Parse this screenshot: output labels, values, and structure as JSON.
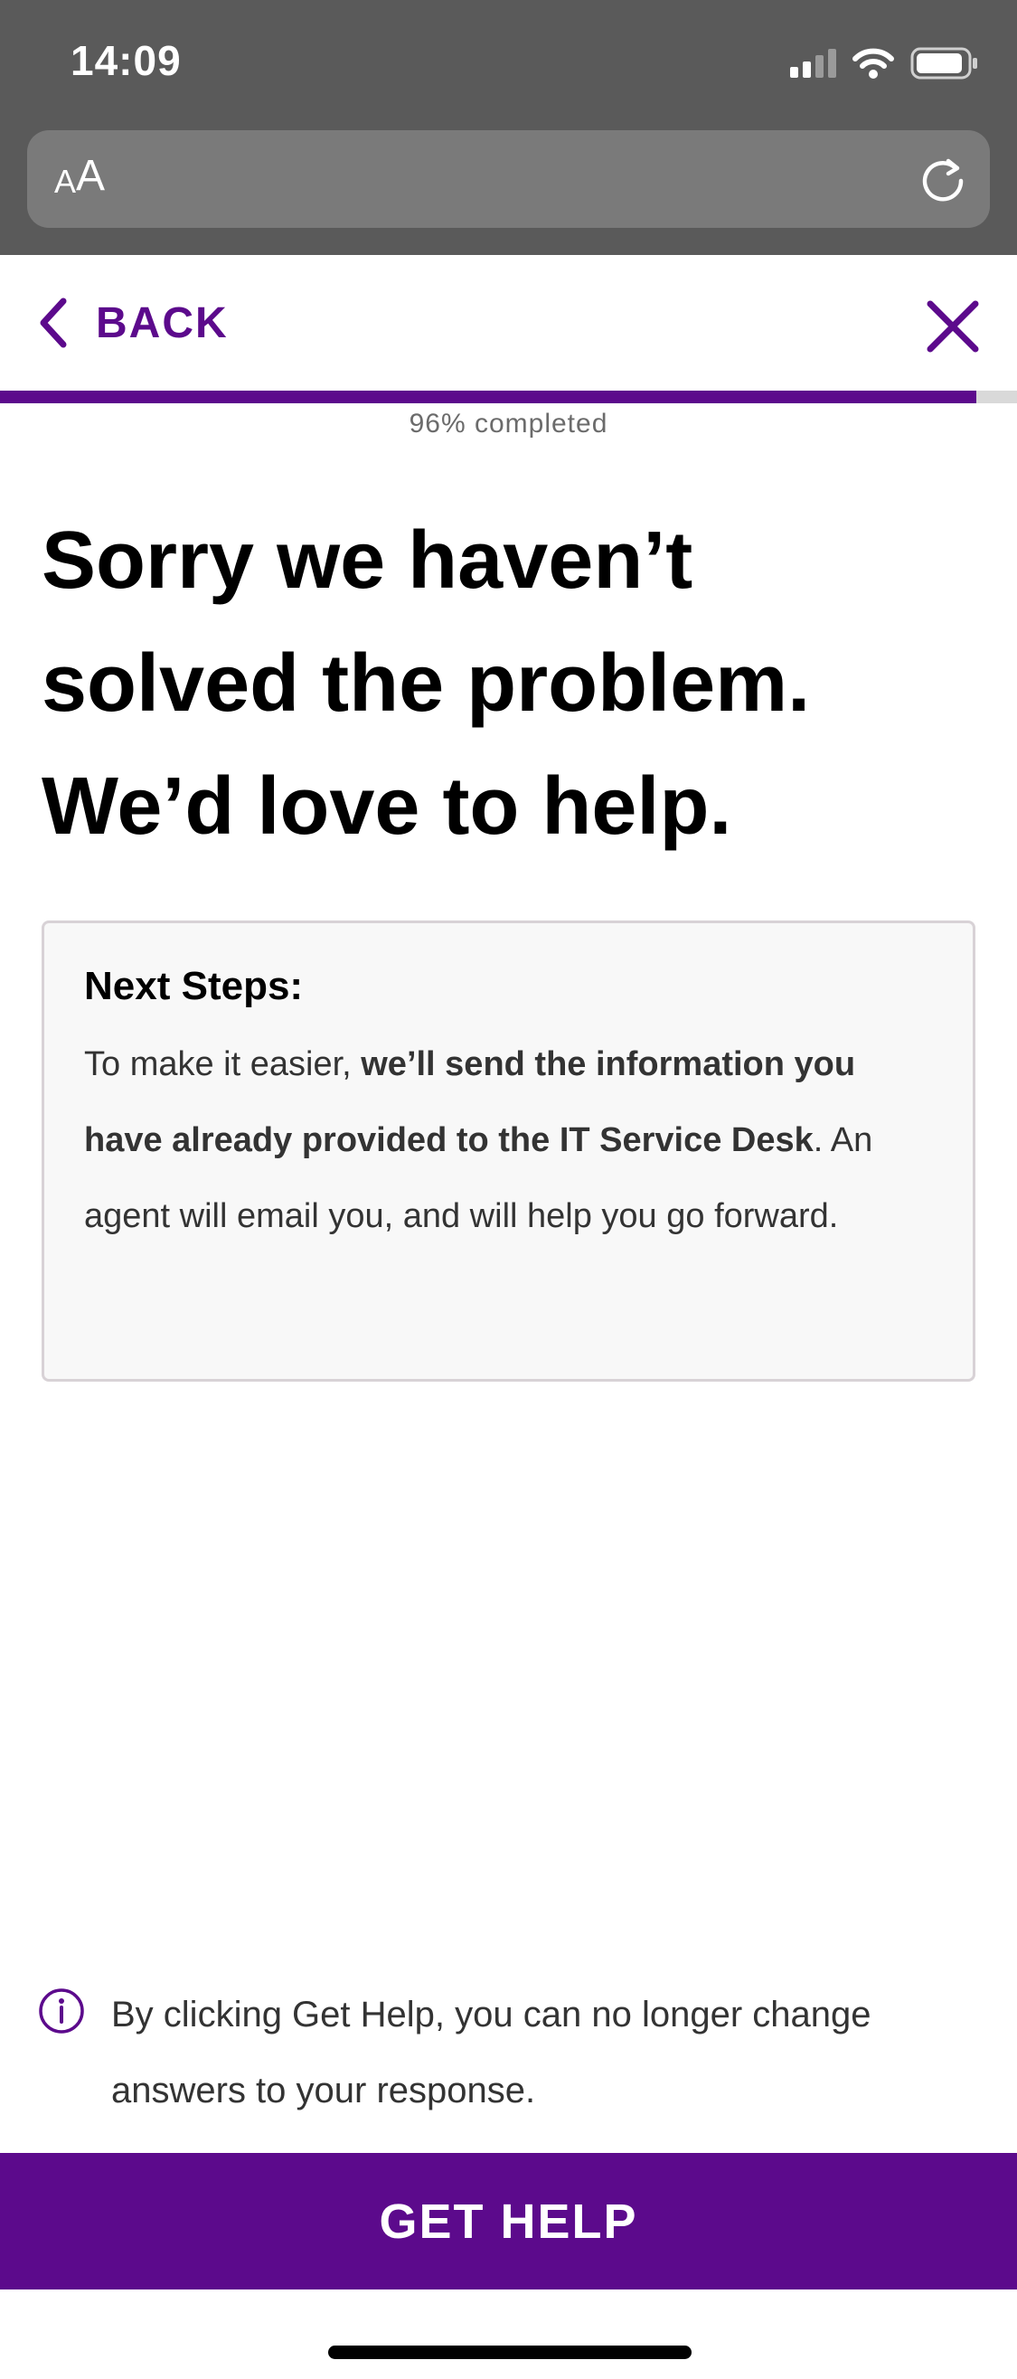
{
  "status_bar": {
    "time": "14:09",
    "signal_icon": "cellular-signal-icon",
    "wifi_icon": "wifi-icon",
    "battery_icon": "battery-icon"
  },
  "browser": {
    "text_size_button_small": "A",
    "text_size_button_large": "A",
    "reload_icon": "reload-icon"
  },
  "header": {
    "back_label": "BACK",
    "back_icon": "chevron-left-icon",
    "close_icon": "close-icon",
    "accent_color": "#5c0a8c"
  },
  "progress": {
    "percent": 96,
    "label": "96% completed"
  },
  "main": {
    "title_lines": [
      "Sorry we haven’t",
      "solved the problem.",
      "We’d love to help."
    ]
  },
  "next_steps": {
    "title": "Next Steps:",
    "text_before": "To make it easier, ",
    "text_bold": "we’ll send the information you have already provided to the IT Service Desk",
    "text_after": ". An agent will email you, and will help you go forward."
  },
  "info_note": {
    "icon": "info-icon",
    "text": "By clicking Get Help, you can no longer change answers to your response."
  },
  "footer": {
    "button_label": "GET HELP"
  }
}
